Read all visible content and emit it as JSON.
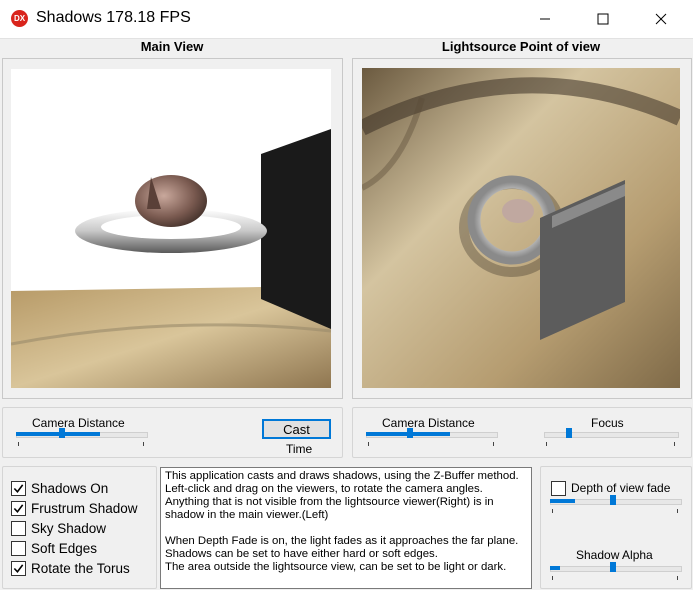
{
  "window": {
    "title": "Shadows 178.18 FPS",
    "icon_text": "DX"
  },
  "titlebar_buttons": {
    "minimize": "minimize-icon",
    "maximize": "maximize-icon",
    "close": "close-icon"
  },
  "views": {
    "main_title": "Main View",
    "light_title": "Lightsource Point of view"
  },
  "left_controls": {
    "camera_distance_label": "Camera Distance",
    "camera_distance_value": 0.35,
    "cast_label": "Cast",
    "time_label": "Time"
  },
  "right_controls": {
    "camera_distance_label": "Camera Distance",
    "camera_distance_value": 0.33,
    "focus_label": "Focus",
    "focus_value": 0.17
  },
  "options": [
    {
      "label": "Shadows On",
      "checked": true
    },
    {
      "label": "Frustrum Shadow",
      "checked": true
    },
    {
      "label": "Sky Shadow",
      "checked": false
    },
    {
      "label": "Soft Edges",
      "checked": false
    },
    {
      "label": "Rotate the Torus",
      "checked": true
    }
  ],
  "description": "This application casts and draws shadows, using the Z-Buffer method.\nLeft-click and drag on the viewers, to rotate the camera angles.\nAnything that is not visible from the lightsource viewer(Right) is in\nshadow in the main viewer.(Left)\n\nWhen Depth Fade is on, the light fades as it approaches the far plane.\nShadows can be set to have either hard or soft edges.\nThe area outside the lightsource view, can be set to be light or dark.",
  "depth_fade": {
    "label": "Depth of view fade",
    "checked": false,
    "value": 0.48
  },
  "shadow_alpha": {
    "label": "Shadow Alpha",
    "value": 0.48
  },
  "colors": {
    "accent": "#0078d7",
    "background": "#f0f0f0",
    "icon_red": "#d9241c"
  }
}
